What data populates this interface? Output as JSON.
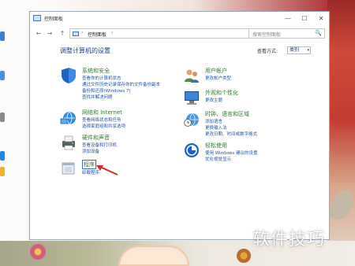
{
  "window": {
    "title": "控制面板",
    "controls": {
      "minimize": "—",
      "maximize": "☐",
      "close": "✕"
    }
  },
  "address": {
    "back": "←",
    "forward": "→",
    "up": "↑",
    "separator": "›",
    "path": "控制面板",
    "path_sep_end": "›",
    "dropdown": "⌄",
    "refresh": "↻"
  },
  "search": {
    "placeholder": "搜索控制面板",
    "icon": "🔍"
  },
  "main": {
    "heading": "调整计算机的设置",
    "view_by_label": "查看方式:",
    "view_by_value": "类别",
    "view_by_caret": "▾"
  },
  "categories_left": [
    {
      "title": "系统和安全",
      "icon": "shield-icon",
      "links": [
        "查看你的计算机状态",
        "通过文件历史记录保存你的文件备份副本",
        "备份和还原(Windows 7)",
        "查找并解决问题"
      ]
    },
    {
      "title": "网络和 Internet",
      "icon": "network-globe-icon",
      "links": [
        "查看网络状态和任务",
        "选择家庭组和共享选项"
      ]
    },
    {
      "title": "硬件和声音",
      "icon": "printer-icon",
      "links": [
        "查看设备和打印机",
        "添加设备"
      ]
    },
    {
      "title": "程序",
      "icon": "programs-icon",
      "links": [
        "卸载程序"
      ]
    }
  ],
  "categories_right": [
    {
      "title": "用户帐户",
      "icon": "users-icon",
      "links": [
        "更改帐户类型"
      ]
    },
    {
      "title": "外观和个性化",
      "icon": "monitor-icon",
      "links": [
        "更改主题"
      ]
    },
    {
      "title": "时钟、语言和区域",
      "icon": "clock-globe-icon",
      "links": [
        "添加语言",
        "更换输入法",
        "更改日期、时间或数字格式"
      ]
    },
    {
      "title": "轻松使用",
      "icon": "accessibility-icon",
      "links": [
        "使用 Windows 建议的设置",
        "优化视觉显示"
      ]
    }
  ],
  "watermark": "软件技巧",
  "colors": {
    "category_title": "#2f7a2f",
    "link": "#1f52a8",
    "heading": "#1e3f82",
    "arrow": "#d22a2a"
  }
}
